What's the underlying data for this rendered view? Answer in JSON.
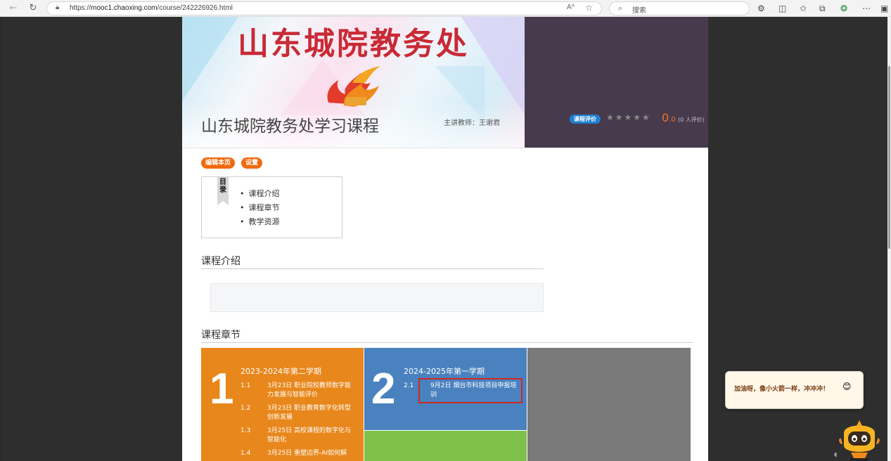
{
  "browser": {
    "url_prefix": "https://",
    "url_domain": "mooc1.chaoxing.com",
    "url_path": "/course/242226926.html",
    "search_placeholder": "搜索",
    "reader_label": "Aᴬ"
  },
  "banner": {
    "title": "山东城院教务处",
    "course_name": "山东城院教务处学习课程",
    "teacher": "主讲教师：王谢君",
    "eval_label": "课程评价",
    "stars": "★★★★★",
    "score_int": "0",
    "score_dec": ".0",
    "raters": "(0 人评价)"
  },
  "actions": {
    "edit_label": "编辑本页",
    "settings_label": "设置"
  },
  "toc": {
    "flag": "目录",
    "items": [
      "课程介绍",
      "课程章节",
      "教学资源"
    ]
  },
  "sections": {
    "intro_title": "课程介绍",
    "chapters_title": "课程章节"
  },
  "terms": [
    {
      "number": "1",
      "name": "2023-2024年第二学期",
      "chapters": [
        {
          "n": "1.1",
          "t": "3月23日 职业院校教师数字能力发展与智能评价"
        },
        {
          "n": "1.2",
          "t": "3月23日 职业教育数字化转型创新发展"
        },
        {
          "n": "1.3",
          "t": "3月25日 高校课程的数字化与智能化"
        },
        {
          "n": "1.4",
          "t": "3月25日 重塑边界-AI如何解"
        }
      ]
    },
    {
      "number": "2",
      "name": "2024-2025年第一学期",
      "chapters": [
        {
          "n": "2.1",
          "t": "9月2日 烟台市科技项目申报培训"
        }
      ]
    }
  ],
  "assistant": {
    "message": "加油呀，像小火箭一样，冲冲冲！",
    "emoji": "😊"
  },
  "colors": {
    "accent_orange": "#f06a0f",
    "tile_orange": "#e8871b",
    "tile_blue": "#4a82c0",
    "tile_green": "#7fc04a",
    "tile_gray": "#7a7a7a",
    "title_red": "#c92a35",
    "highlight_red": "#d0281f"
  }
}
